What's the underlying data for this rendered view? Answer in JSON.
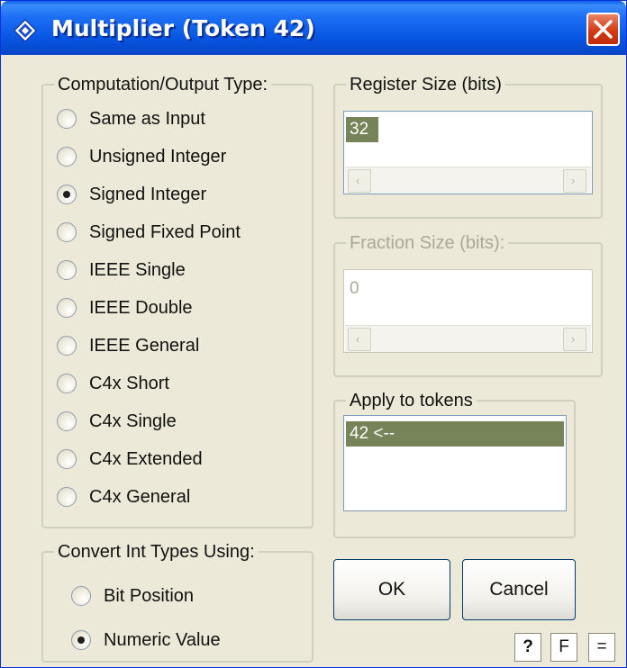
{
  "window": {
    "title": "Multiplier (Token 42)"
  },
  "computation": {
    "legend": "Computation/Output Type:",
    "options": [
      {
        "label": "Same as Input",
        "checked": false
      },
      {
        "label": "Unsigned Integer",
        "checked": false
      },
      {
        "label": "Signed Integer",
        "checked": true
      },
      {
        "label": "Signed Fixed Point",
        "checked": false
      },
      {
        "label": "IEEE Single",
        "checked": false
      },
      {
        "label": "IEEE Double",
        "checked": false
      },
      {
        "label": "IEEE General",
        "checked": false
      },
      {
        "label": "C4x Short",
        "checked": false
      },
      {
        "label": "C4x Single",
        "checked": false
      },
      {
        "label": "C4x Extended",
        "checked": false
      },
      {
        "label": "C4x General",
        "checked": false
      }
    ]
  },
  "convert": {
    "legend": "Convert Int Types Using:",
    "options": [
      {
        "label": "Bit Position",
        "checked": false
      },
      {
        "label": "Numeric Value",
        "checked": true
      }
    ]
  },
  "register_size": {
    "legend": "Register Size (bits)",
    "value": "32"
  },
  "fraction_size": {
    "legend": "Fraction Size (bits):",
    "value": "0",
    "disabled": true
  },
  "apply_tokens": {
    "legend": "Apply to tokens",
    "items": [
      "42 <--"
    ]
  },
  "buttons": {
    "ok": "OK",
    "cancel": "Cancel",
    "help": "?",
    "f": "F",
    "eq": "="
  }
}
